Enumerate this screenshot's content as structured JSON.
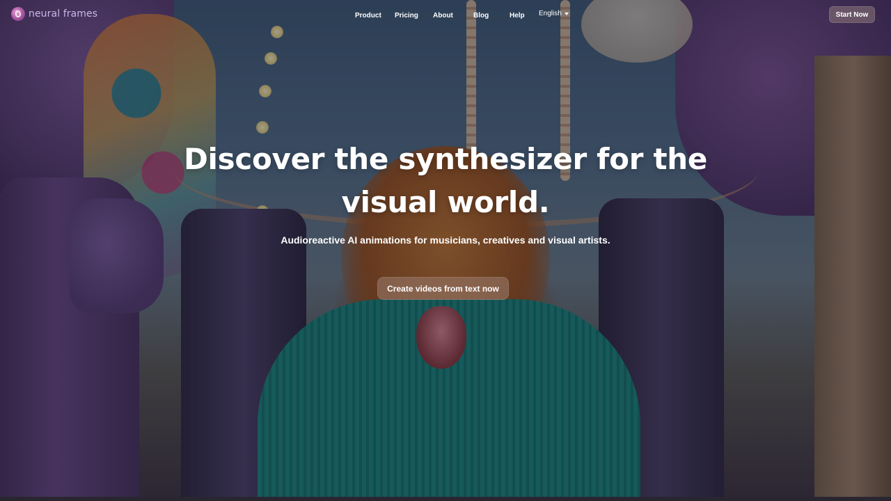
{
  "nav": {
    "logo_text": "neural frames",
    "logo_icon": "neural-frames-logo-icon",
    "links": [
      {
        "label": "Product"
      },
      {
        "label": "Pricing"
      },
      {
        "label": "About"
      },
      {
        "label": "Blog"
      },
      {
        "label": "Help"
      }
    ],
    "language": {
      "selected": "English",
      "icon": "chevron-down-icon"
    },
    "start_button": "Start Now"
  },
  "hero": {
    "headline_line1": "Discover the synthesizer for the",
    "headline_line2": "visual world.",
    "subheadline": "Audioreactive AI animations for musicians, creatives and visual artists.",
    "cta_label": "Create videos from text now"
  }
}
